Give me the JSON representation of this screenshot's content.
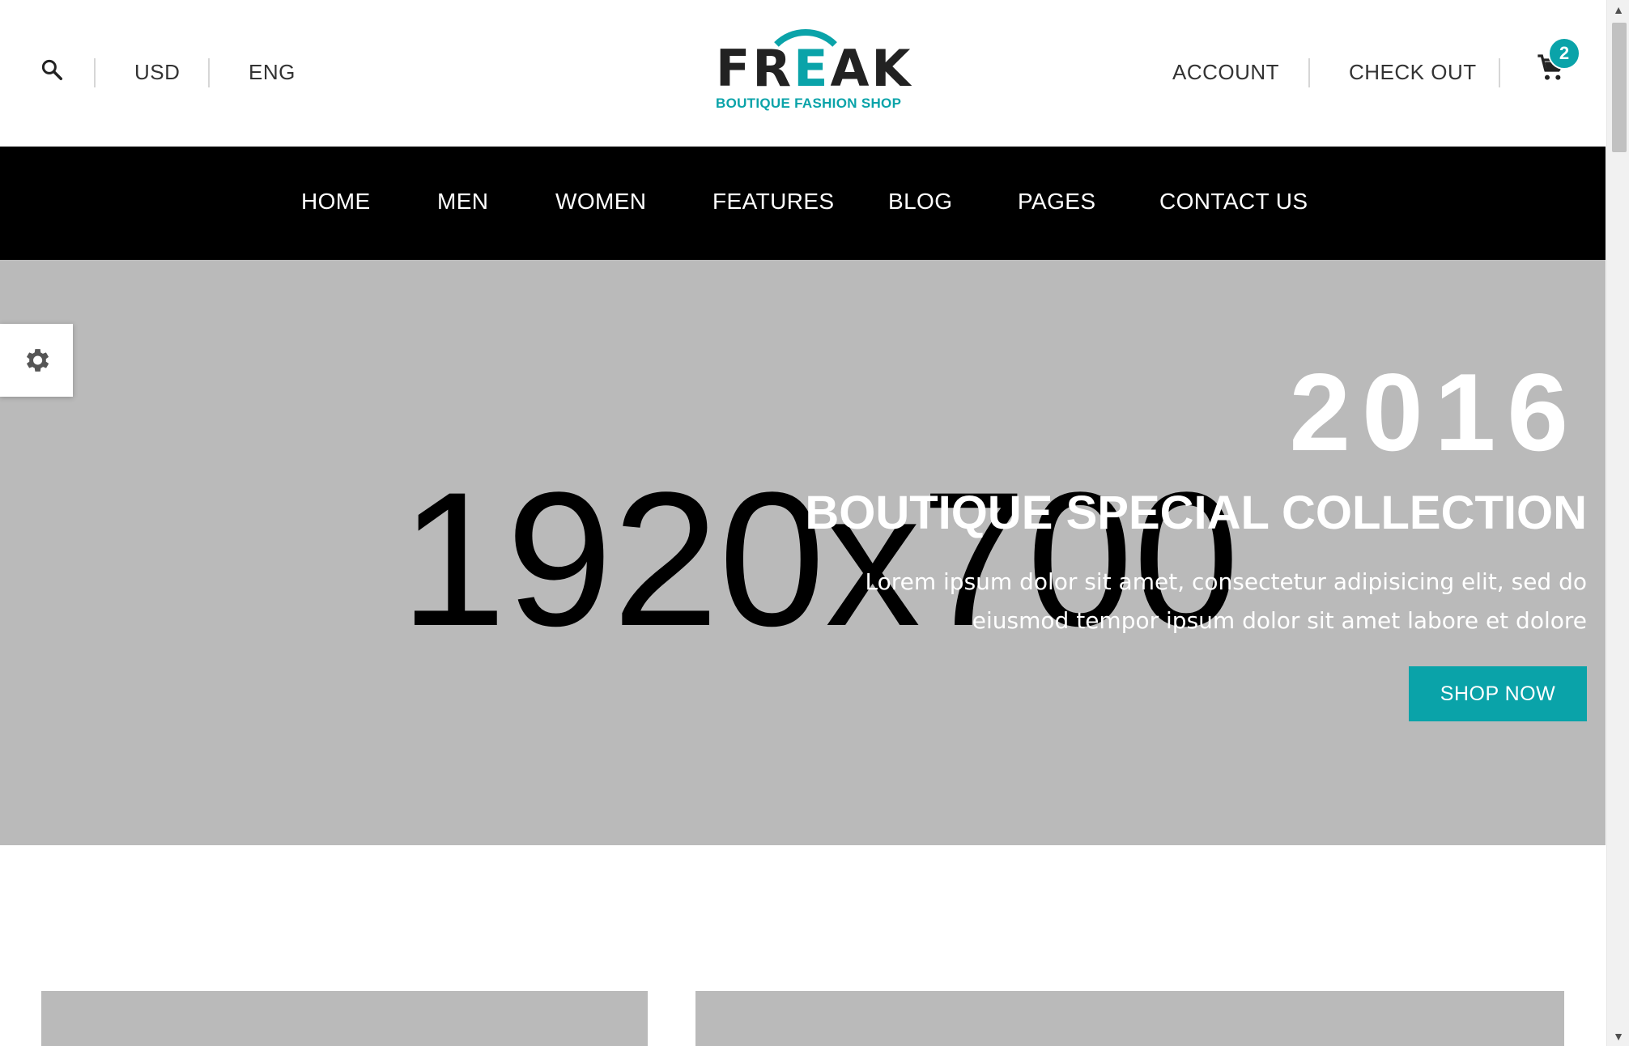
{
  "header": {
    "currency": "USD",
    "language": "ENG",
    "account_label": "ACCOUNT",
    "checkout_label": "CHECK OUT",
    "cart_count": "2",
    "logo": {
      "brand": "FREAK",
      "tagline": "BOUTIQUE FASHION SHOP"
    }
  },
  "nav": {
    "items": [
      {
        "label": "HOME"
      },
      {
        "label": "MEN"
      },
      {
        "label": "WOMEN"
      },
      {
        "label": "FEATURES"
      },
      {
        "label": "BLOG"
      },
      {
        "label": "PAGES"
      },
      {
        "label": "CONTACT US"
      }
    ]
  },
  "hero": {
    "placeholder": "1920x700",
    "year": "2016",
    "title": "BOUTIQUE SPECIAL COLLECTION",
    "description": "Lorem ipsum dolor sit amet, consectetur adipisicing elit, sed do eiusmod tempor ipsum dolor sit amet labore et dolore",
    "cta_label": "SHOP NOW"
  },
  "icons": {
    "search": "search-icon",
    "cart": "cart-icon",
    "settings": "gear-icon"
  },
  "colors": {
    "accent": "#0aa3a9",
    "nav_bg": "#000000",
    "placeholder_bg": "#bababa"
  }
}
